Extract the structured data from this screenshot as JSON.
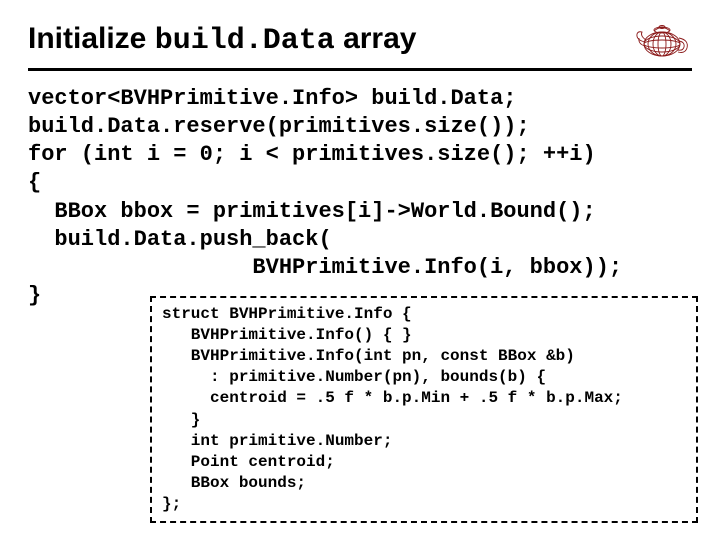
{
  "title_prefix": "Initialize ",
  "title_code": "build.Data",
  "title_suffix": " array",
  "code_main": "vector<BVHPrimitive.Info> build.Data;\nbuild.Data.reserve(primitives.size());\nfor (int i = 0; i < primitives.size(); ++i)\n{\n  BBox bbox = primitives[i]->World.Bound();\n  build.Data.push_back(\n                 BVHPrimitive.Info(i, bbox));\n}",
  "code_struct": "struct BVHPrimitive.Info {\n   BVHPrimitive.Info() { }\n   BVHPrimitive.Info(int pn, const BBox &b)\n     : primitive.Number(pn), bounds(b) {\n     centroid = .5 f * b.p.Min + .5 f * b.p.Max;\n   }\n   int primitive.Number;\n   Point centroid;\n   BBox bounds;\n};"
}
